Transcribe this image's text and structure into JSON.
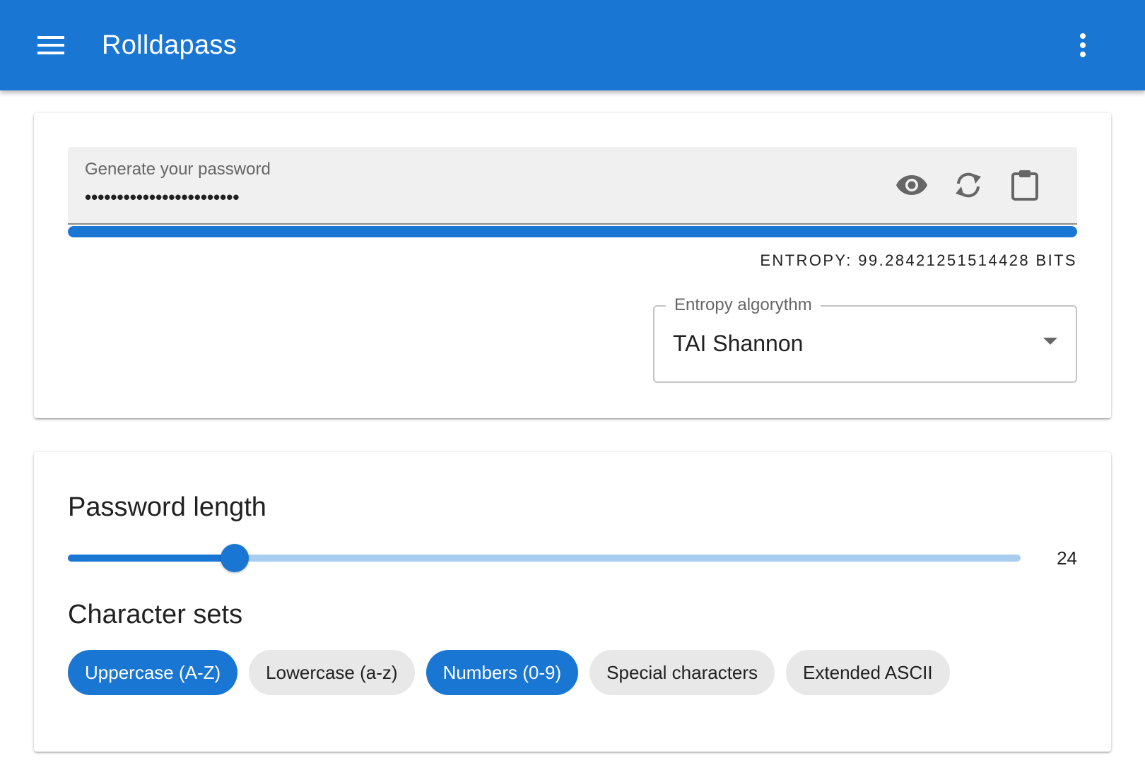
{
  "appbar": {
    "title": "Rolldapass",
    "menu_icon": "menu-icon",
    "more_icon": "more-vert-icon",
    "color": "#1976d2"
  },
  "password": {
    "label": "Generate your password",
    "value": "••••••••••••••••••••••••",
    "actions": [
      {
        "name": "show-password",
        "icon": "eye-icon"
      },
      {
        "name": "regenerate",
        "icon": "refresh-icon"
      },
      {
        "name": "copy",
        "icon": "clipboard-icon"
      }
    ],
    "strength_fraction": 1.0
  },
  "entropy": {
    "text": "Entropy: 99.28421251514428 bits"
  },
  "algorithm": {
    "label": "Entropy algorythm",
    "value": "TAI Shannon"
  },
  "length": {
    "title": "Password length",
    "value": "24",
    "fraction": 0.175
  },
  "charsets": {
    "title": "Character sets",
    "items": [
      {
        "label": "Uppercase (A-Z)",
        "selected": true
      },
      {
        "label": "Lowercase (a-z)",
        "selected": false
      },
      {
        "label": "Numbers (0-9)",
        "selected": true
      },
      {
        "label": "Special characters",
        "selected": false
      },
      {
        "label": "Extended ASCII",
        "selected": false
      }
    ]
  }
}
